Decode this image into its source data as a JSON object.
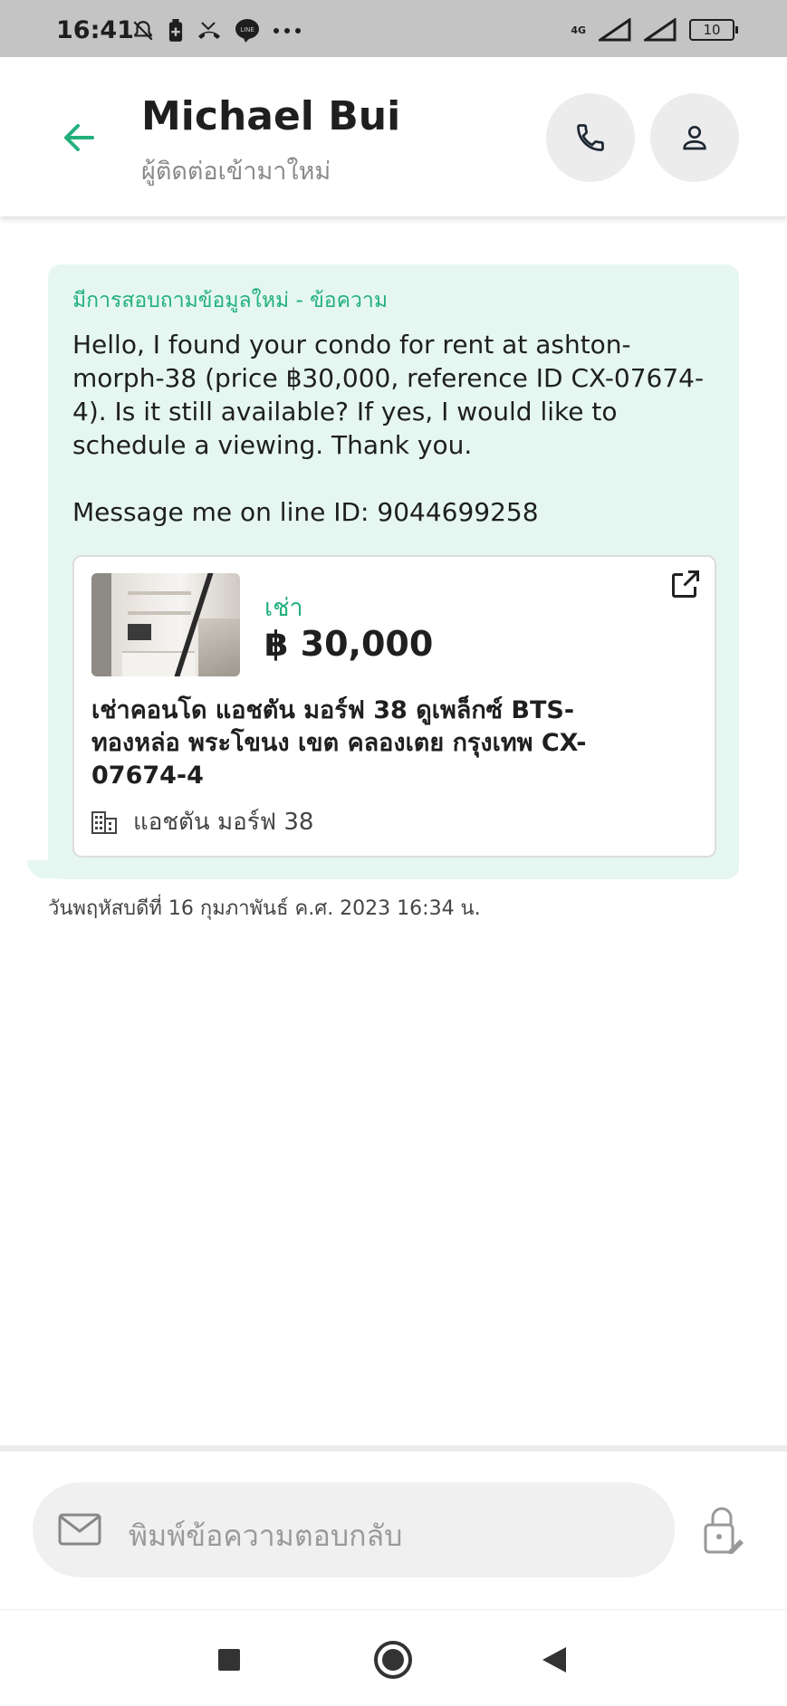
{
  "status_bar": {
    "time": "16:41",
    "network": "4G",
    "battery": "10",
    "icons": [
      "notifications-off-icon",
      "battery-saver-icon",
      "missed-call-icon",
      "line-app-icon",
      "more-dots-icon"
    ]
  },
  "header": {
    "contact_name": "Michael Bui",
    "contact_subtitle": "ผู้ติดต่อเข้ามาใหม่",
    "accent_color": "#22b07d"
  },
  "message": {
    "title": "มีการสอบถามข้อมูลใหม่ - ข้อความ",
    "body": "Hello, I found your condo for rent at ashton-morph-38 (price ฿30,000, reference ID CX-07674-4). Is it still available? If yes, I would like to schedule a viewing. Thank you.\n\nMessage me on line ID: 9044699258",
    "timestamp": "วันพฤหัสบดีที่ 16 กุมภาพันธ์ ค.ศ. 2023 16:34 น.",
    "bubble_color": "#e5f7f0"
  },
  "listing": {
    "type": "เช่า",
    "price": "฿ 30,000",
    "title": "เช่าคอนโด  แอชตัน มอร์ฟ 38 ดูเพล็กซ์ BTS-ทองหล่อ พระโขนง เขต คลองเตย กรุงเทพ CX-07674-4",
    "location": "แอชตัน มอร์ฟ 38"
  },
  "composer": {
    "placeholder": "พิมพ์ข้อความตอบกลับ"
  },
  "nav": {
    "buttons": [
      "recents-square-icon",
      "home-circle-icon",
      "back-triangle-icon"
    ]
  }
}
